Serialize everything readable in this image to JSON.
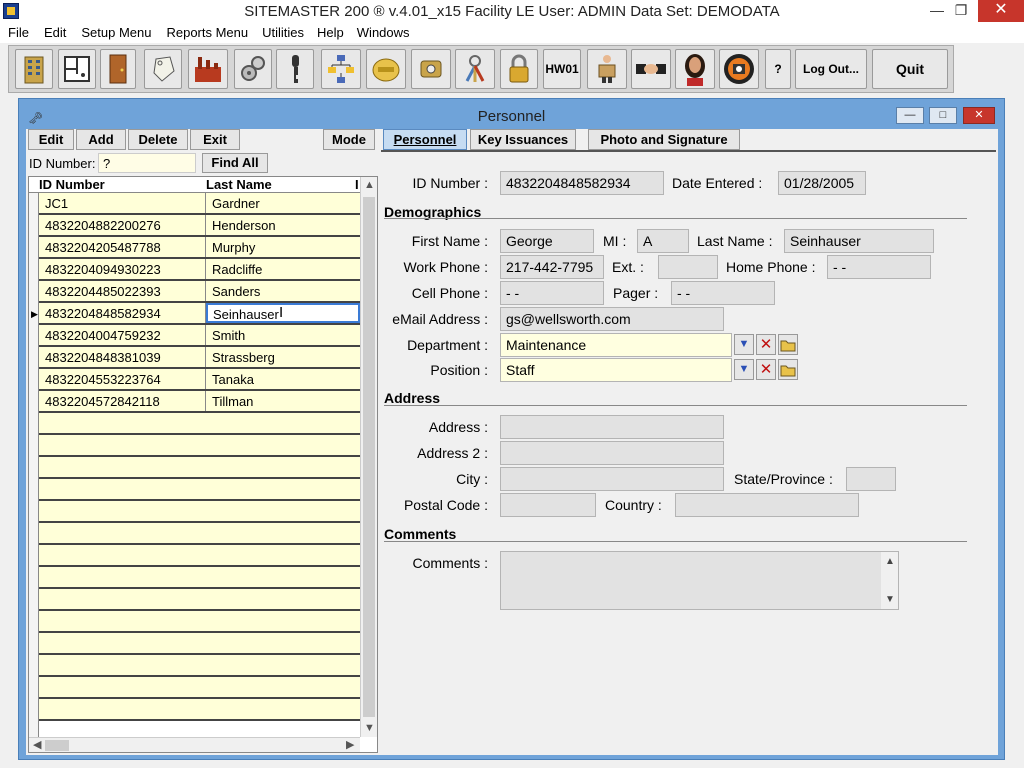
{
  "app": {
    "title": "SITEMASTER 200 ® v.4.01_x15 Facility LE    User: ADMIN    Data Set: DEMODATA",
    "min": "—",
    "restore": "❐",
    "close": "✕"
  },
  "menu": [
    "File",
    "Edit",
    "Setup Menu",
    "Reports Menu",
    "Utilities",
    "Help",
    "Windows"
  ],
  "toolbar": {
    "hw01": "HW01",
    "logout": "Log Out...",
    "quit": "Quit",
    "help": "?"
  },
  "window": {
    "title": "Personnel",
    "icon": "🗝",
    "min": "—",
    "max": "□",
    "close": "✕"
  },
  "actions": {
    "edit": "Edit",
    "add": "Add",
    "delete": "Delete",
    "exit": "Exit",
    "mode": "Mode"
  },
  "tabs": {
    "personnel": "Personnel",
    "key_issuances": "Key Issuances",
    "photo_signature": "Photo and Signature"
  },
  "search": {
    "label": "ID Number:",
    "value": "?",
    "find_all": "Find All"
  },
  "grid": {
    "headers": [
      "ID Number",
      "Last Name",
      "I"
    ],
    "rows": [
      {
        "id": "JC1",
        "last": "Gardner"
      },
      {
        "id": "4832204882200276",
        "last": "Henderson"
      },
      {
        "id": "4832204205487788",
        "last": "Murphy"
      },
      {
        "id": "4832204094930223",
        "last": "Radcliffe"
      },
      {
        "id": "4832204485022393",
        "last": "Sanders"
      },
      {
        "id": "4832204848582934",
        "last": "Seinhauser"
      },
      {
        "id": "4832204004759232",
        "last": "Smith"
      },
      {
        "id": "4832204848381039",
        "last": "Strassberg"
      },
      {
        "id": "4832204553223764",
        "last": "Tanaka"
      },
      {
        "id": "4832204572842118",
        "last": "Tillman"
      }
    ],
    "selected_index": 5
  },
  "form": {
    "id_number_label": "ID Number :",
    "id_number": "4832204848582934",
    "date_entered_label": "Date Entered :",
    "date_entered": "01/28/2005",
    "demographics_title": "Demographics",
    "first_name_label": "First Name :",
    "first_name": "George",
    "mi_label": "MI :",
    "mi": "A",
    "last_name_label": "Last Name :",
    "last_name": "Seinhauser",
    "work_phone_label": "Work Phone :",
    "work_phone": "217-442-7795",
    "ext_label": "Ext. :",
    "ext": "",
    "home_phone_label": "Home Phone :",
    "home_phone": "   -   -",
    "cell_phone_label": "Cell Phone :",
    "cell_phone": "   -   -",
    "pager_label": "Pager :",
    "pager": "   -   -",
    "email_label": "eMail Address :",
    "email": "gs@wellsworth.com",
    "department_label": "Department :",
    "department": "Maintenance",
    "position_label": "Position :",
    "position": "Staff",
    "address_title": "Address",
    "address_label": "Address :",
    "address": "",
    "address2_label": "Address 2 :",
    "address2": "",
    "city_label": "City :",
    "city": "",
    "state_label": "State/Province :",
    "state": "",
    "postal_label": "Postal Code :",
    "postal": "",
    "country_label": "Country :",
    "country": "",
    "comments_title": "Comments",
    "comments_label": "Comments :",
    "comments": ""
  }
}
